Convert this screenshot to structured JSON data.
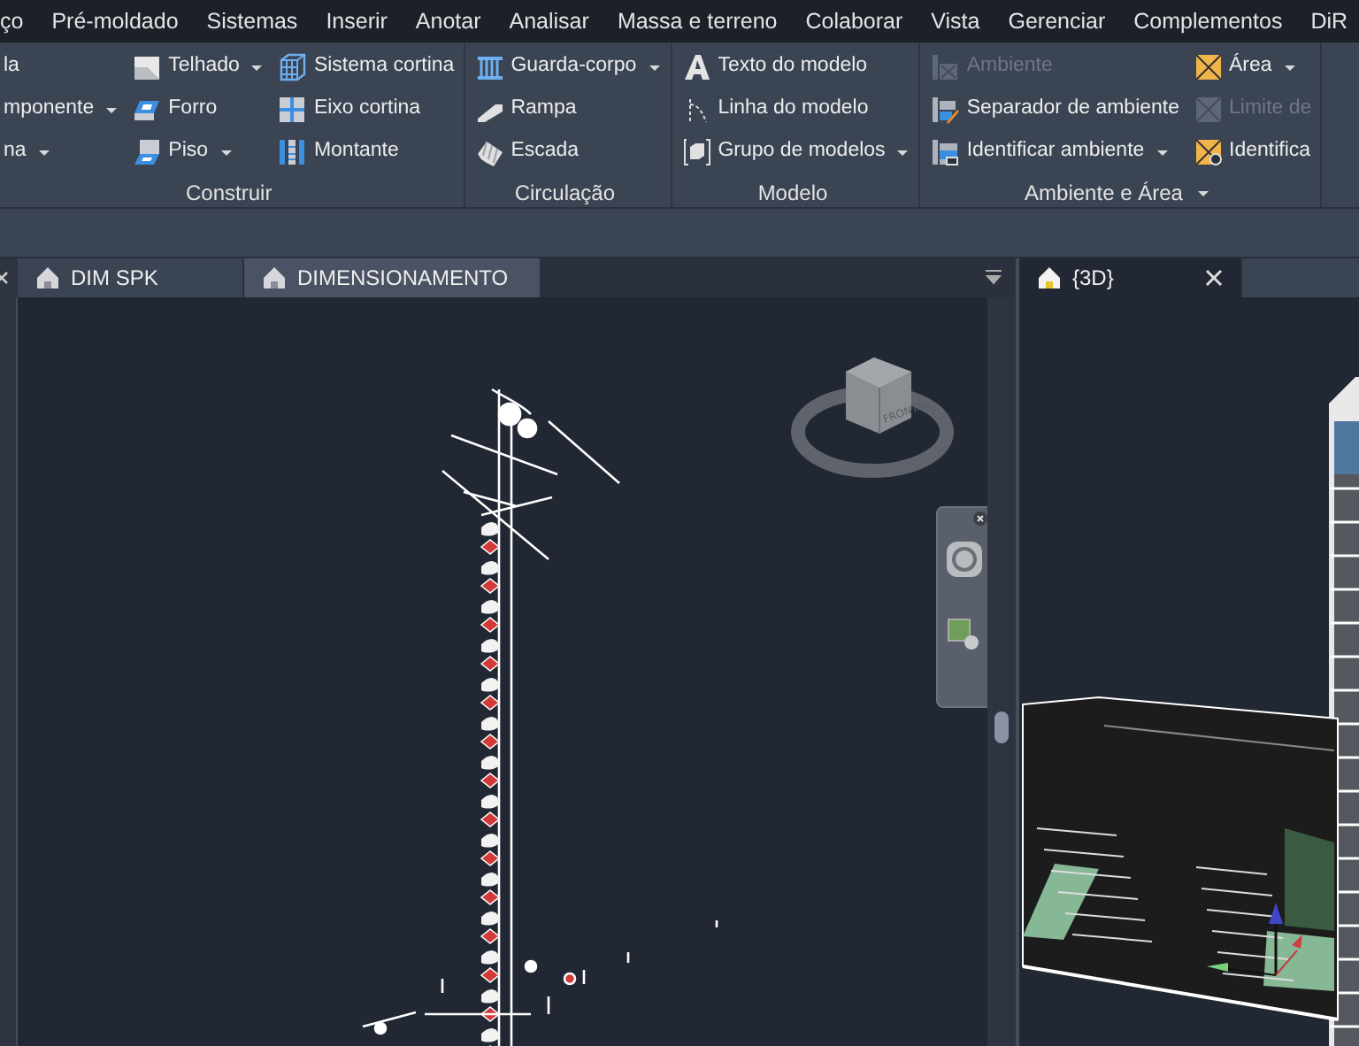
{
  "menu": [
    {
      "label": "ço"
    },
    {
      "label": "Pré-moldado"
    },
    {
      "label": "Sistemas"
    },
    {
      "label": "Inserir"
    },
    {
      "label": "Anotar"
    },
    {
      "label": "Analisar"
    },
    {
      "label": "Massa e terreno"
    },
    {
      "label": "Colaborar"
    },
    {
      "label": "Vista"
    },
    {
      "label": "Gerenciar"
    },
    {
      "label": "Complementos"
    },
    {
      "label": "DiR"
    }
  ],
  "ribbon": {
    "panels": [
      {
        "title": "Construir",
        "title_dropdown": false,
        "columns": [
          [
            {
              "label": "la",
              "dropdown": false,
              "disabled": false
            },
            {
              "label": "mponente",
              "dropdown": true,
              "disabled": false
            },
            {
              "label": "na",
              "dropdown": true,
              "disabled": false
            }
          ],
          [
            {
              "label": "Telhado",
              "dropdown": true,
              "disabled": false
            },
            {
              "label": "Forro",
              "dropdown": false,
              "disabled": false
            },
            {
              "label": "Piso",
              "dropdown": true,
              "disabled": false
            }
          ],
          [
            {
              "label": "Sistema cortina",
              "dropdown": false,
              "disabled": false
            },
            {
              "label": "Eixo cortina",
              "dropdown": false,
              "disabled": false
            },
            {
              "label": "Montante",
              "dropdown": false,
              "disabled": false
            }
          ]
        ]
      },
      {
        "title": "Circulação",
        "title_dropdown": false,
        "columns": [
          [
            {
              "label": "Guarda-corpo",
              "dropdown": true,
              "disabled": false
            },
            {
              "label": "Rampa",
              "dropdown": false,
              "disabled": false
            },
            {
              "label": "Escada",
              "dropdown": false,
              "disabled": false
            }
          ]
        ]
      },
      {
        "title": "Modelo",
        "title_dropdown": false,
        "columns": [
          [
            {
              "label": "Texto do modelo",
              "dropdown": false,
              "disabled": false
            },
            {
              "label": "Linha do modelo",
              "dropdown": false,
              "disabled": false
            },
            {
              "label": "Grupo de modelos",
              "dropdown": true,
              "disabled": false
            }
          ]
        ]
      },
      {
        "title": "Ambiente e Área",
        "title_dropdown": true,
        "columns": [
          [
            {
              "label": "Ambiente",
              "dropdown": false,
              "disabled": true
            },
            {
              "label": "Separador de ambiente",
              "dropdown": false,
              "disabled": false
            },
            {
              "label": "Identificar ambiente",
              "dropdown": true,
              "disabled": false
            }
          ],
          [
            {
              "label": "Área",
              "dropdown": true,
              "disabled": false
            },
            {
              "label": "Limite de",
              "dropdown": false,
              "disabled": true
            },
            {
              "label": "Identifica",
              "dropdown": false,
              "disabled": false
            }
          ]
        ]
      }
    ]
  },
  "left_view": {
    "tabs": [
      {
        "label": "DIM SPK",
        "selected": false
      },
      {
        "label": "DIMENSIONAMENTO",
        "selected": true
      }
    ],
    "viewcube_face": "FRONTAL"
  },
  "right_view": {
    "tabs": [
      {
        "label": "{3D}",
        "selected": true
      }
    ]
  }
}
